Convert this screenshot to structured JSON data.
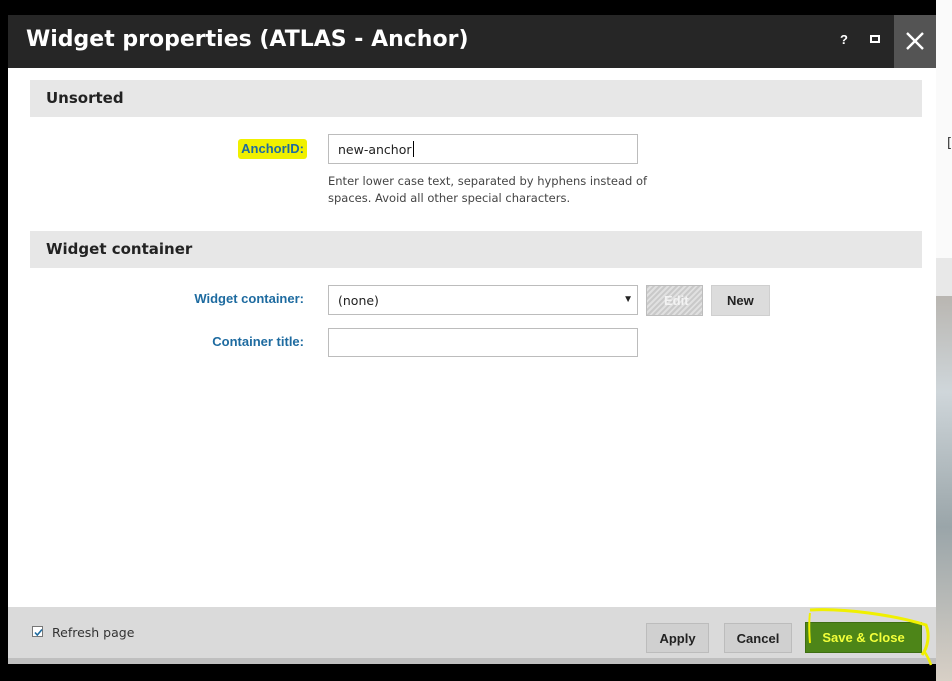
{
  "dialog": {
    "title": "Widget properties (ATLAS - Anchor)",
    "help_label": "?",
    "icons": {
      "maximize": "maximize-icon",
      "close": "close-icon"
    }
  },
  "sections": {
    "unsorted": "Unsorted",
    "widget_container": "Widget container"
  },
  "fields": {
    "anchor_id": {
      "label": "AnchorID:",
      "value": "new-anchor",
      "hint": "Enter lower case text, separated by hyphens instead of spaces. Avoid all other special characters."
    },
    "widget_container": {
      "label": "Widget container:",
      "selected": "(none)",
      "edit_label": "Edit",
      "new_label": "New"
    },
    "container_title": {
      "label": "Container title:",
      "value": ""
    }
  },
  "footer": {
    "refresh_checked": true,
    "refresh_label": "Refresh page",
    "apply_label": "Apply",
    "cancel_label": "Cancel",
    "save_close_label": "Save & Close"
  },
  "background": {
    "edge_char": "["
  },
  "colors": {
    "titlebar": "#262626",
    "label_blue": "#1e6ba0",
    "highlight": "#f0f000",
    "save_button": "#4d8518",
    "save_text": "#f2ff3a"
  }
}
